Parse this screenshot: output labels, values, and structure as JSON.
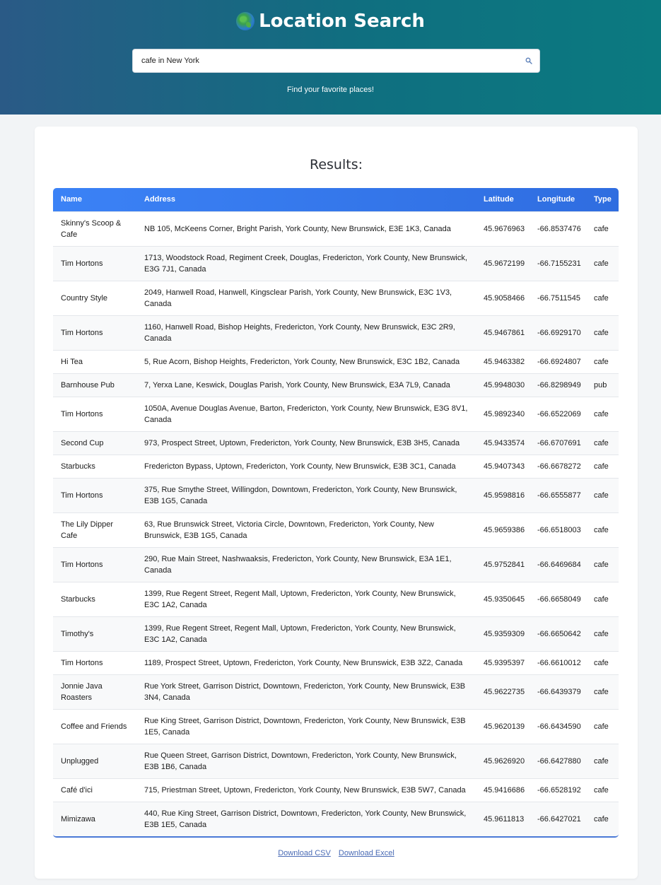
{
  "header": {
    "title": "Location Search",
    "search_value": "cafe in New York",
    "subtitle": "Find your favorite places!"
  },
  "results": {
    "title": "Results:",
    "columns": [
      "Name",
      "Address",
      "Latitude",
      "Longitude",
      "Type"
    ],
    "rows": [
      {
        "name": "Skinny's Scoop & Cafe",
        "address": "NB 105, McKeens Corner, Bright Parish, York County, New Brunswick, E3E 1K3, Canada",
        "lat": "45.9676963",
        "lon": "-66.8537476",
        "type": "cafe"
      },
      {
        "name": "Tim Hortons",
        "address": "1713, Woodstock Road, Regiment Creek, Douglas, Fredericton, York County, New Brunswick, E3G 7J1, Canada",
        "lat": "45.9672199",
        "lon": "-66.7155231",
        "type": "cafe"
      },
      {
        "name": "Country Style",
        "address": "2049, Hanwell Road, Hanwell, Kingsclear Parish, York County, New Brunswick, E3C 1V3, Canada",
        "lat": "45.9058466",
        "lon": "-66.7511545",
        "type": "cafe"
      },
      {
        "name": "Tim Hortons",
        "address": "1160, Hanwell Road, Bishop Heights, Fredericton, York County, New Brunswick, E3C 2R9, Canada",
        "lat": "45.9467861",
        "lon": "-66.6929170",
        "type": "cafe"
      },
      {
        "name": "Hi Tea",
        "address": "5, Rue Acorn, Bishop Heights, Fredericton, York County, New Brunswick, E3C 1B2, Canada",
        "lat": "45.9463382",
        "lon": "-66.6924807",
        "type": "cafe"
      },
      {
        "name": "Barnhouse Pub",
        "address": "7, Yerxa Lane, Keswick, Douglas Parish, York County, New Brunswick, E3A 7L9, Canada",
        "lat": "45.9948030",
        "lon": "-66.8298949",
        "type": "pub"
      },
      {
        "name": "Tim Hortons",
        "address": "1050A, Avenue Douglas Avenue, Barton, Fredericton, York County, New Brunswick, E3G 8V1, Canada",
        "lat": "45.9892340",
        "lon": "-66.6522069",
        "type": "cafe"
      },
      {
        "name": "Second Cup",
        "address": "973, Prospect Street, Uptown, Fredericton, York County, New Brunswick, E3B 3H5, Canada",
        "lat": "45.9433574",
        "lon": "-66.6707691",
        "type": "cafe"
      },
      {
        "name": "Starbucks",
        "address": "Fredericton Bypass, Uptown, Fredericton, York County, New Brunswick, E3B 3C1, Canada",
        "lat": "45.9407343",
        "lon": "-66.6678272",
        "type": "cafe"
      },
      {
        "name": "Tim Hortons",
        "address": "375, Rue Smythe Street, Willingdon, Downtown, Fredericton, York County, New Brunswick, E3B 1G5, Canada",
        "lat": "45.9598816",
        "lon": "-66.6555877",
        "type": "cafe"
      },
      {
        "name": "The Lily Dipper Cafe",
        "address": "63, Rue Brunswick Street, Victoria Circle, Downtown, Fredericton, York County, New Brunswick, E3B 1G5, Canada",
        "lat": "45.9659386",
        "lon": "-66.6518003",
        "type": "cafe"
      },
      {
        "name": "Tim Hortons",
        "address": "290, Rue Main Street, Nashwaaksis, Fredericton, York County, New Brunswick, E3A 1E1, Canada",
        "lat": "45.9752841",
        "lon": "-66.6469684",
        "type": "cafe"
      },
      {
        "name": "Starbucks",
        "address": "1399, Rue Regent Street, Regent Mall, Uptown, Fredericton, York County, New Brunswick, E3C 1A2, Canada",
        "lat": "45.9350645",
        "lon": "-66.6658049",
        "type": "cafe"
      },
      {
        "name": "Timothy's",
        "address": "1399, Rue Regent Street, Regent Mall, Uptown, Fredericton, York County, New Brunswick, E3C 1A2, Canada",
        "lat": "45.9359309",
        "lon": "-66.6650642",
        "type": "cafe"
      },
      {
        "name": "Tim Hortons",
        "address": "1189, Prospect Street, Uptown, Fredericton, York County, New Brunswick, E3B 3Z2, Canada",
        "lat": "45.9395397",
        "lon": "-66.6610012",
        "type": "cafe"
      },
      {
        "name": "Jonnie Java Roasters",
        "address": "Rue York Street, Garrison District, Downtown, Fredericton, York County, New Brunswick, E3B 3N4, Canada",
        "lat": "45.9622735",
        "lon": "-66.6439379",
        "type": "cafe"
      },
      {
        "name": "Coffee and Friends",
        "address": "Rue King Street, Garrison District, Downtown, Fredericton, York County, New Brunswick, E3B 1E5, Canada",
        "lat": "45.9620139",
        "lon": "-66.6434590",
        "type": "cafe"
      },
      {
        "name": "Unplugged",
        "address": "Rue Queen Street, Garrison District, Downtown, Fredericton, York County, New Brunswick, E3B 1B6, Canada",
        "lat": "45.9626920",
        "lon": "-66.6427880",
        "type": "cafe"
      },
      {
        "name": "Café d'ici",
        "address": "715, Priestman Street, Uptown, Fredericton, York County, New Brunswick, E3B 5W7, Canada",
        "lat": "45.9416686",
        "lon": "-66.6528192",
        "type": "cafe"
      },
      {
        "name": "Mimizawa",
        "address": "440, Rue King Street, Garrison District, Downtown, Fredericton, York County, New Brunswick, E3B 1E5, Canada",
        "lat": "45.9611813",
        "lon": "-66.6427021",
        "type": "cafe"
      }
    ]
  },
  "downloads": {
    "csv": "Download CSV",
    "excel": "Download Excel"
  },
  "colors": {
    "header_gradient_start": "#2a5a86",
    "header_gradient_end": "#0b7a80",
    "table_header": "#3b82f6",
    "link": "#4a6bb5"
  }
}
